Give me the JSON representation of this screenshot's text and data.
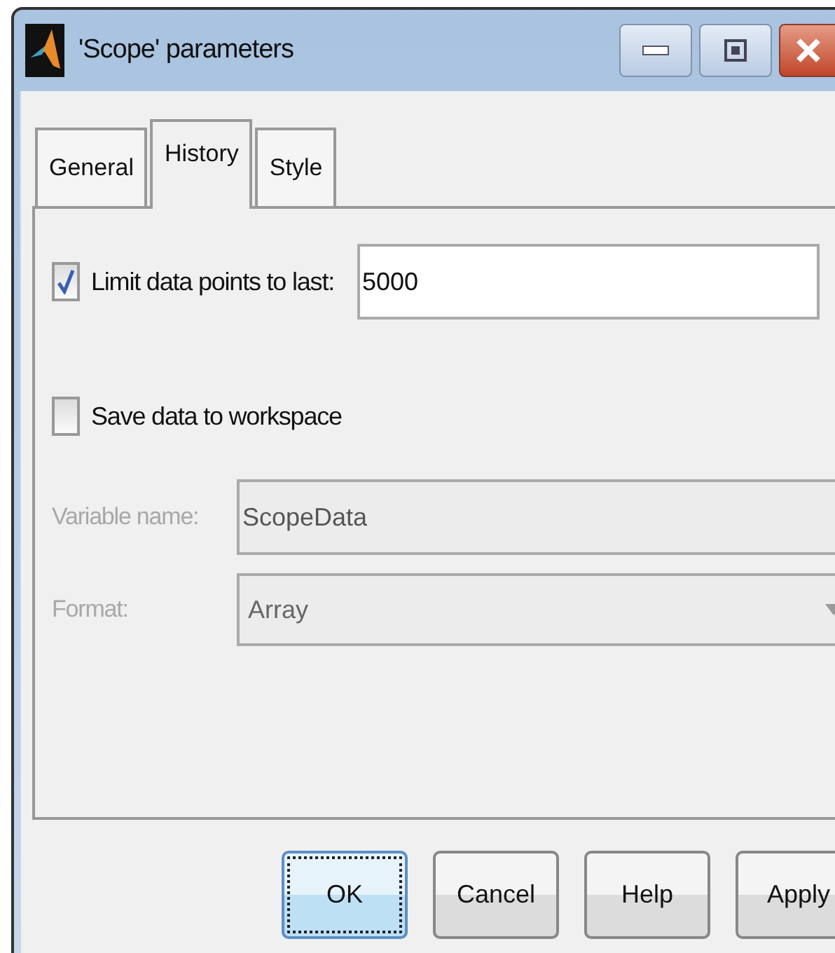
{
  "window": {
    "title": "'Scope' parameters"
  },
  "tabs": [
    {
      "label": "General",
      "selected": false
    },
    {
      "label": "History",
      "selected": true
    },
    {
      "label": "Style",
      "selected": false
    }
  ],
  "limit": {
    "label": "Limit data points to last:",
    "checked": true,
    "value": "5000"
  },
  "save": {
    "label": "Save data to workspace",
    "checked": false
  },
  "variable_name": {
    "label": "Variable name:",
    "value": "ScopeData",
    "disabled": true
  },
  "format": {
    "label": "Format:",
    "value": "Array",
    "disabled": true
  },
  "buttons": [
    {
      "label": "OK",
      "default": true
    },
    {
      "label": "Cancel",
      "default": false
    },
    {
      "label": "Help",
      "default": false
    },
    {
      "label": "Apply",
      "default": false
    }
  ]
}
